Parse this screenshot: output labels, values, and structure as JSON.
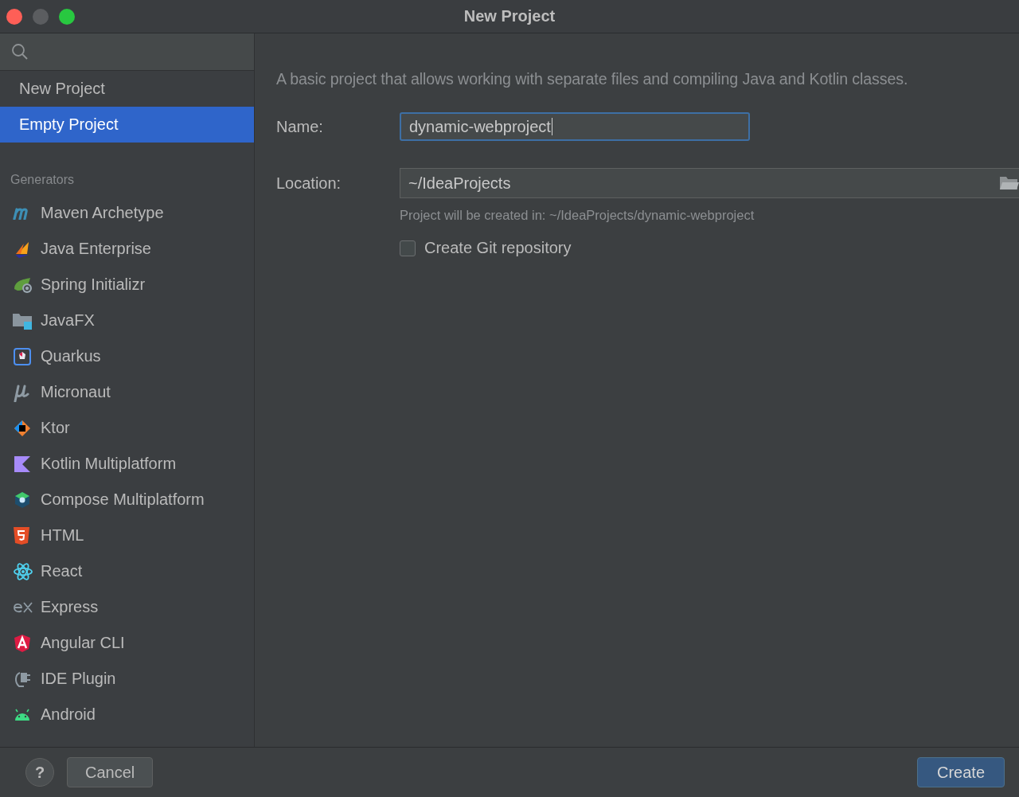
{
  "window": {
    "title": "New Project"
  },
  "sidebar": {
    "items": [
      {
        "label": "New Project",
        "selected": false
      },
      {
        "label": "Empty Project",
        "selected": true
      }
    ],
    "generators_heading": "Generators",
    "generators": [
      {
        "label": "Maven Archetype",
        "selected": false
      },
      {
        "label": "Java Enterprise",
        "selected": false
      },
      {
        "label": "Spring Initializr",
        "selected": false
      },
      {
        "label": "JavaFX",
        "selected": false
      },
      {
        "label": "Quarkus",
        "selected": false
      },
      {
        "label": "Micronaut",
        "selected": false
      },
      {
        "label": "Ktor",
        "selected": false
      },
      {
        "label": "Kotlin Multiplatform",
        "selected": false
      },
      {
        "label": "Compose Multiplatform",
        "selected": false
      },
      {
        "label": "HTML",
        "selected": false
      },
      {
        "label": "React",
        "selected": false
      },
      {
        "label": "Express",
        "selected": false
      },
      {
        "label": "Angular CLI",
        "selected": false
      },
      {
        "label": "IDE Plugin",
        "selected": false
      },
      {
        "label": "Android",
        "selected": false
      }
    ]
  },
  "form": {
    "description": "A basic project that allows working with separate files and compiling Java and Kotlin classes.",
    "name": {
      "label": "Name:",
      "value": "dynamic-webproject"
    },
    "location": {
      "label": "Location:",
      "value": "~/IdeaProjects",
      "hint": "Project will be created in: ~/IdeaProjects/dynamic-webproject"
    },
    "git": {
      "label": "Create Git repository",
      "checked": false
    }
  },
  "footer": {
    "help": "?",
    "cancel": "Cancel",
    "create": "Create"
  }
}
